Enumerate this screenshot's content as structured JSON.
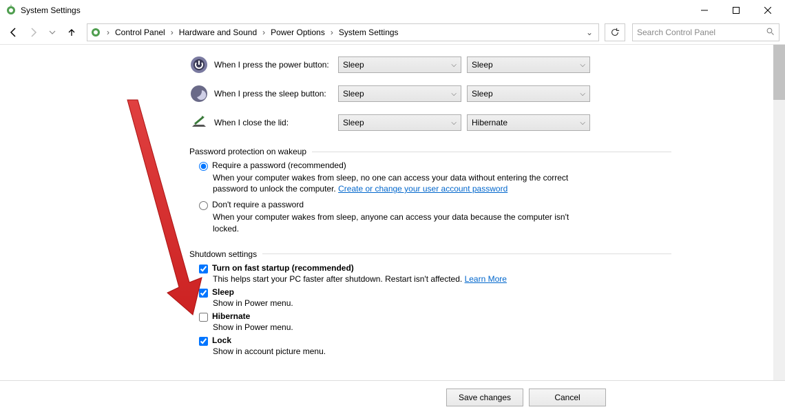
{
  "window": {
    "title": "System Settings"
  },
  "breadcrumbs": {
    "items": [
      "Control Panel",
      "Hardware and Sound",
      "Power Options",
      "System Settings"
    ]
  },
  "search": {
    "placeholder": "Search Control Panel"
  },
  "actions": {
    "power_button": {
      "label": "When I press the power button:",
      "battery": "Sleep",
      "plugged": "Sleep"
    },
    "sleep_button": {
      "label": "When I press the sleep button:",
      "battery": "Sleep",
      "plugged": "Sleep"
    },
    "close_lid": {
      "label": "When I close the lid:",
      "battery": "Sleep",
      "plugged": "Hibernate"
    }
  },
  "password": {
    "header": "Password protection on wakeup",
    "require_label": "Require a password (recommended)",
    "require_desc_a": "When your computer wakes from sleep, no one can access your data without entering the correct password to unlock the computer. ",
    "require_link": "Create or change your user account password",
    "dont_label": "Don't require a password",
    "dont_desc": "When your computer wakes from sleep, anyone can access your data because the computer isn't locked."
  },
  "shutdown": {
    "header": "Shutdown settings",
    "fast_label": "Turn on fast startup (recommended)",
    "fast_desc": "This helps start your PC faster after shutdown. Restart isn't affected. ",
    "fast_link": "Learn More",
    "sleep_label": "Sleep",
    "sleep_desc": "Show in Power menu.",
    "hibernate_label": "Hibernate",
    "hibernate_desc": "Show in Power menu.",
    "lock_label": "Lock",
    "lock_desc": "Show in account picture menu."
  },
  "footer": {
    "save": "Save changes",
    "cancel": "Cancel"
  }
}
